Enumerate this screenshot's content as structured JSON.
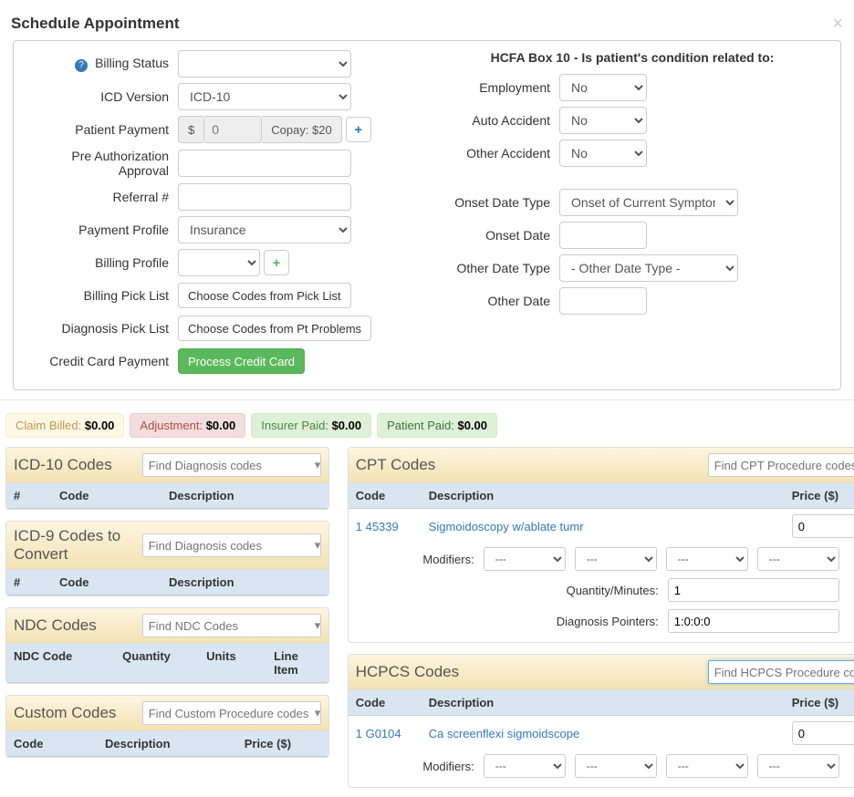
{
  "header": {
    "title": "Schedule Appointment"
  },
  "left": {
    "billing_status_label": "Billing Status",
    "icd_version_label": "ICD Version",
    "icd_version_value": "ICD-10",
    "patient_payment_label": "Patient Payment",
    "patient_payment_currency": "$",
    "patient_payment_value": "0",
    "copay_label": "Copay: $20",
    "pre_auth_label": "Pre Authorization Approval",
    "referral_label": "Referral #",
    "payment_profile_label": "Payment Profile",
    "payment_profile_value": "Insurance",
    "billing_profile_label": "Billing Profile",
    "billing_picklist_label": "Billing Pick List",
    "billing_picklist_btn": "Choose Codes from Pick List",
    "diagnosis_picklist_label": "Diagnosis Pick List",
    "diagnosis_picklist_btn": "Choose Codes from Pt Problems",
    "cc_payment_label": "Credit Card Payment",
    "cc_payment_btn": "Process Credit Card"
  },
  "right": {
    "hcfa_title": "HCFA Box 10 - Is patient's condition related to:",
    "employment_label": "Employment",
    "employment_value": "No",
    "auto_accident_label": "Auto Accident",
    "auto_accident_value": "No",
    "other_accident_label": "Other Accident",
    "other_accident_value": "No",
    "onset_type_label": "Onset Date Type",
    "onset_type_value": "Onset of Current Symptoms o",
    "onset_date_label": "Onset Date",
    "other_type_label": "Other Date Type",
    "other_type_value": "- Other Date Type -",
    "other_date_label": "Other Date"
  },
  "badges": {
    "claim_billed_label": "Claim Billed:",
    "claim_billed_val": "$0.00",
    "adjustment_label": "Adjustment:",
    "adjustment_val": "$0.00",
    "insurer_paid_label": "Insurer Paid:",
    "insurer_paid_val": "$0.00",
    "patient_paid_label": "Patient Paid:",
    "patient_paid_val": "$0.00"
  },
  "icd10": {
    "title": "ICD-10 Codes",
    "search_ph": "Find Diagnosis codes",
    "col_num": "#",
    "col_code": "Code",
    "col_desc": "Description"
  },
  "icd9": {
    "title": "ICD-9 Codes to Convert",
    "search_ph": "Find Diagnosis codes",
    "col_num": "#",
    "col_code": "Code",
    "col_desc": "Description"
  },
  "ndc": {
    "title": "NDC Codes",
    "search_ph": "Find NDC Codes",
    "col_code": "NDC Code",
    "col_qty": "Quantity",
    "col_units": "Units",
    "col_line": "Line Item"
  },
  "custom": {
    "title": "Custom Codes",
    "search_ph": "Find Custom Procedure codes",
    "col_code": "Code",
    "col_desc": "Description",
    "col_price": "Price ($)"
  },
  "cpt": {
    "title": "CPT Codes",
    "search_ph": "Find CPT Procedure codes",
    "col_code": "Code",
    "col_desc": "Description",
    "col_price": "Price ($)",
    "row_num": "1",
    "row_code": "45339",
    "row_desc": "Sigmoidoscopy w/ablate tumr",
    "row_price": "0",
    "modifiers_label": "Modifiers:",
    "mod_val": "---",
    "qty_label": "Quantity/Minutes:",
    "qty_val": "1",
    "dp_label": "Diagnosis Pointers:",
    "dp_val": "1:0:0:0"
  },
  "hcpcs": {
    "title": "HCPCS Codes",
    "search_ph": "Find HCPCS Procedure codes",
    "col_code": "Code",
    "col_desc": "Description",
    "col_price": "Price ($)",
    "row_num": "1",
    "row_code": "G0104",
    "row_desc": "Ca screenflexi sigmoidscope",
    "row_price": "0",
    "modifiers_label": "Modifiers:",
    "mod_val": "---"
  }
}
